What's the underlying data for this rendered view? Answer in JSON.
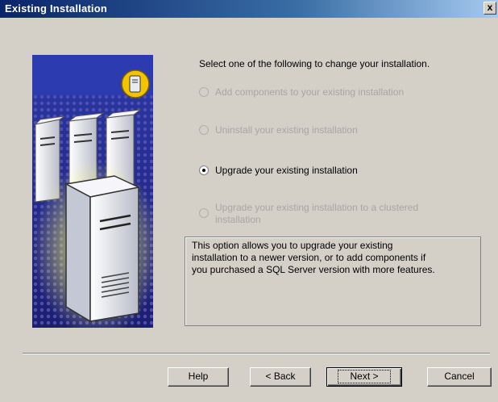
{
  "window": {
    "title": "Existing Installation",
    "close_glyph": "x"
  },
  "instruction": "Select one of the following to change your installation.",
  "options": [
    {
      "label": "Add components to your existing installation",
      "enabled": false,
      "selected": false
    },
    {
      "label": "Uninstall your existing installation",
      "enabled": false,
      "selected": false
    },
    {
      "label": "Upgrade your existing installation",
      "enabled": true,
      "selected": true
    },
    {
      "label_line1": "Upgrade your existing installation to a clustered",
      "label_line2": "installation",
      "enabled": false,
      "selected": false
    }
  ],
  "description": {
    "line1": "This option allows you to upgrade your existing",
    "line2": "installation to a newer version, or to add components if",
    "line3": "you purchased a SQL Server version with more features."
  },
  "buttons": {
    "help": "Help",
    "back": "< Back",
    "next": "Next >",
    "cancel": "Cancel"
  },
  "colors": {
    "title_gradient_start": "#0a246a",
    "dialog_face": "#d4d0c8",
    "art_background": "#1f2a8a",
    "badge_yellow": "#f2c400"
  },
  "icons": {
    "badge": "server-document-icon",
    "servers": "server-towers-icon"
  }
}
